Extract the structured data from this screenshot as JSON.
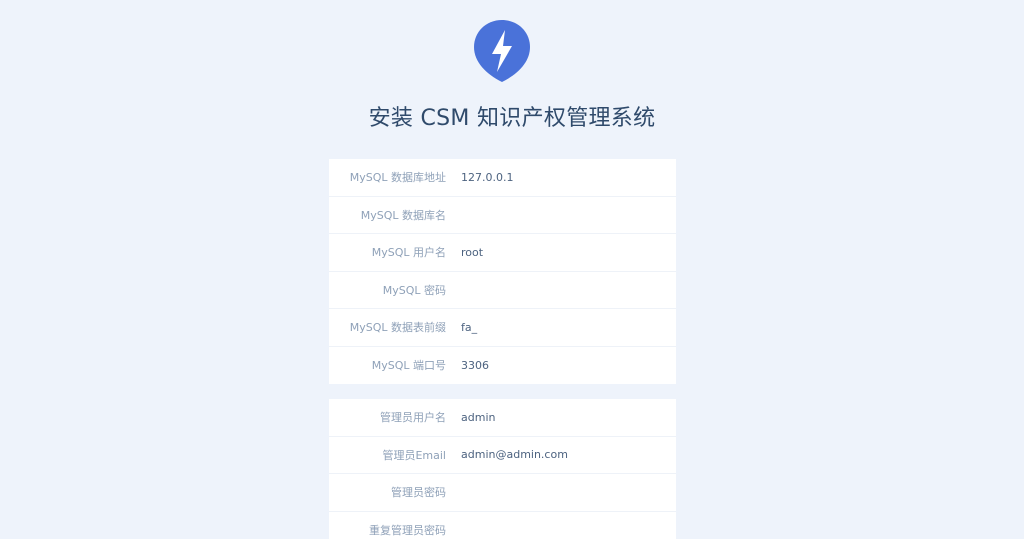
{
  "header": {
    "logo_icon": "lightning-bolt-icon",
    "title": "安装 CSM 知识产权管理系统"
  },
  "database_section": {
    "fields": [
      {
        "label": "MySQL 数据库地址",
        "value": "127.0.0.1"
      },
      {
        "label": "MySQL 数据库名",
        "value": ""
      },
      {
        "label": "MySQL 用户名",
        "value": "root"
      },
      {
        "label": "MySQL 密码",
        "value": ""
      },
      {
        "label": "MySQL 数据表前缀",
        "value": "fa_"
      },
      {
        "label": "MySQL 端口号",
        "value": "3306"
      }
    ]
  },
  "admin_section": {
    "fields": [
      {
        "label": "管理员用户名",
        "value": "admin"
      },
      {
        "label": "管理员Email",
        "value": "admin@admin.com"
      },
      {
        "label": "管理员密码",
        "value": ""
      },
      {
        "label": "重复管理员密码",
        "value": ""
      }
    ]
  },
  "colors": {
    "background": "#eef3fb",
    "logo": "#4a72d9",
    "title": "#2f4a6b",
    "label": "#8fa1b8",
    "value": "#4d6380"
  }
}
